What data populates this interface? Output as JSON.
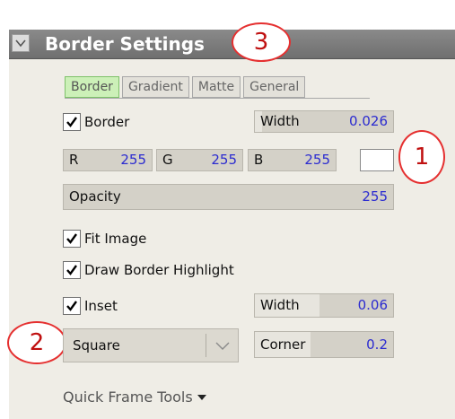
{
  "header": {
    "title": "Border Settings"
  },
  "callouts": [
    "1",
    "2",
    "3"
  ],
  "tabs": [
    {
      "label": "Border",
      "active": true
    },
    {
      "label": "Gradient",
      "active": false
    },
    {
      "label": "Matte",
      "active": false
    },
    {
      "label": "General",
      "active": false
    }
  ],
  "border": {
    "checkbox_label": "Border",
    "checked": true,
    "width_label": "Width",
    "width_value": "0.026",
    "width_fraction": 0.05,
    "r_label": "R",
    "r_value": "255",
    "g_label": "G",
    "g_value": "255",
    "b_label": "B",
    "b_value": "255",
    "swatch_color": "#ffffff",
    "opacity_label": "Opacity",
    "opacity_value": "255",
    "opacity_fraction": 1.0
  },
  "options": {
    "fit_image_label": "Fit Image",
    "fit_image_checked": true,
    "draw_highlight_label": "Draw Border Highlight",
    "draw_highlight_checked": true,
    "inset_label": "Inset",
    "inset_checked": true,
    "inset_width_label": "Width",
    "inset_width_value": "0.06",
    "inset_width_fraction": 0.47,
    "shape_value": "Square",
    "corner_label": "Corner",
    "corner_value": "0.2",
    "corner_fraction": 0.4
  },
  "footer": {
    "quick_tools_label": "Quick Frame Tools"
  },
  "colors": {
    "header_bg": "#777777",
    "panel_bg": "#efede6",
    "value_text": "#2b2bd0",
    "active_tab": "#ccf0b8",
    "callout_ring": "#e53030"
  }
}
